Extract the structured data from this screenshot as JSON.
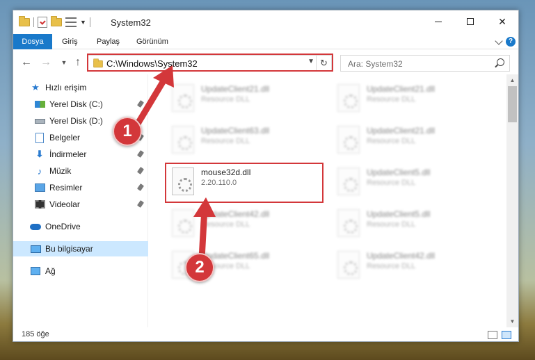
{
  "window": {
    "title": "System32",
    "controls": {
      "minimize": "—",
      "close": "✕"
    }
  },
  "ribbon": {
    "tabs": [
      "Dosya",
      "Giriş",
      "Paylaş",
      "Görünüm"
    ]
  },
  "address": {
    "path": "C:\\Windows\\System32",
    "search_placeholder": "Ara: System32"
  },
  "sidebar": {
    "items": [
      {
        "label": "Hızlı erişim",
        "icon": "star-icon",
        "pinned": false
      },
      {
        "label": "Yerel Disk (C:)",
        "icon": "drive-icon",
        "pinned": true
      },
      {
        "label": "Yerel Disk (D:)",
        "icon": "drive-icon",
        "pinned": true
      },
      {
        "label": "Belgeler",
        "icon": "documents-icon",
        "pinned": true
      },
      {
        "label": "İndirmeler",
        "icon": "downloads-icon",
        "pinned": true
      },
      {
        "label": "Müzik",
        "icon": "music-icon",
        "pinned": true
      },
      {
        "label": "Resimler",
        "icon": "pictures-icon",
        "pinned": true
      },
      {
        "label": "Videolar",
        "icon": "videos-icon",
        "pinned": true
      },
      {
        "label": "OneDrive",
        "icon": "onedrive-icon",
        "pinned": false
      },
      {
        "label": "Bu bilgisayar",
        "icon": "computer-icon",
        "pinned": false,
        "selected": true
      },
      {
        "label": "Ağ",
        "icon": "network-icon",
        "pinned": false
      }
    ]
  },
  "files": {
    "left": [
      {
        "name": "UpdateClient21.dll",
        "sub": "Resource DLL",
        "blurred": true
      },
      {
        "name": "UpdateClient63.dll",
        "sub": "Resource DLL",
        "blurred": true
      },
      {
        "name": "mouse32d.dll",
        "sub": "2.20.110.0",
        "blurred": false
      },
      {
        "name": "UpdateClient42.dll",
        "sub": "Resource DLL",
        "blurred": true
      },
      {
        "name": "UpdateClient65.dll",
        "sub": "Resource DLL",
        "blurred": true
      }
    ],
    "right": [
      {
        "name": "UpdateClient21.dll",
        "sub": "Resource DLL",
        "blurred": true
      },
      {
        "name": "UpdateClient21.dll",
        "sub": "Resource DLL",
        "blurred": true
      },
      {
        "name": "UpdateClient5.dll",
        "sub": "Resource DLL",
        "blurred": true
      },
      {
        "name": "UpdateClient5.dll",
        "sub": "Resource DLL",
        "blurred": true
      },
      {
        "name": "UpdateClient42.dll",
        "sub": "Resource DLL",
        "blurred": true
      }
    ]
  },
  "status": {
    "count": "185 öğe"
  },
  "callouts": [
    "1",
    "2"
  ],
  "colors": {
    "accent": "#1979ca",
    "highlight": "#d3373a",
    "selection": "#cce8ff"
  }
}
